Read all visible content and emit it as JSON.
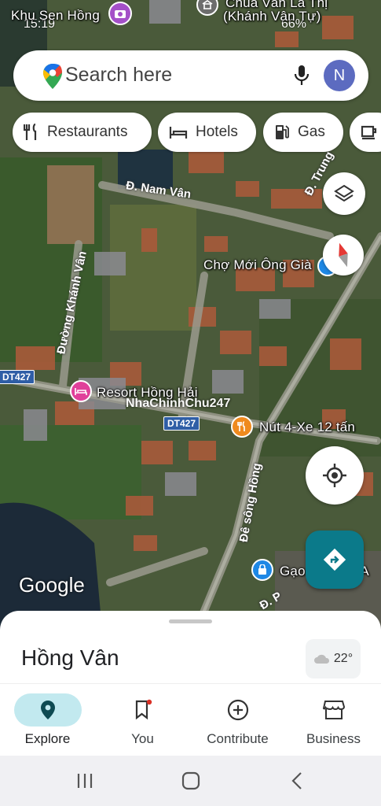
{
  "status_bar": {
    "time": "15:19",
    "battery": "66%"
  },
  "search": {
    "placeholder": "Search here",
    "avatar_letter": "N"
  },
  "chips": [
    {
      "label": "Restaurants",
      "icon": "fork-knife-icon"
    },
    {
      "label": "Hotels",
      "icon": "bed-icon"
    },
    {
      "label": "Gas",
      "icon": "gas-pump-icon"
    },
    {
      "label": "",
      "icon": "coffee-icon"
    }
  ],
  "map": {
    "labels": {
      "khu_sen_hong": "Khu Sen Hồng",
      "chua_van_la": "Chùa Vân La Thị",
      "khanh_van_tu": "(Khánh Vân Tự)",
      "nam_van": "Đ. Nam Vân",
      "trung": "Đ. Trung",
      "cho_moi": "Chợ Mới Ông Già",
      "duong_khanh_van": "Đường Khánh Vân",
      "resort": "Resort Hồng Hải",
      "nut4": "Nút 4-Xe 12 tấn",
      "de_song_hong": "Đê sông Hồng",
      "gao": "Gạo",
      "gao_tail": "m A",
      "dp": "Đ. P"
    },
    "route_badges": {
      "dt427_left": "DT427",
      "dt427_mid": "DT427"
    },
    "watermark": "NhaChinhChu247",
    "attribution": "Google"
  },
  "sheet": {
    "place": "Hồng Vân",
    "temperature": "22°"
  },
  "nav": [
    {
      "label": "Explore",
      "icon": "location-pin-icon",
      "active": true
    },
    {
      "label": "You",
      "icon": "bookmark-icon",
      "active": false
    },
    {
      "label": "Contribute",
      "icon": "plus-circle-icon",
      "active": false
    },
    {
      "label": "Business",
      "icon": "storefront-icon",
      "active": false
    }
  ],
  "colors": {
    "accent": "#0b7a8a",
    "avatar": "#5c6bc0",
    "active_tab": "#c2e9ef"
  }
}
